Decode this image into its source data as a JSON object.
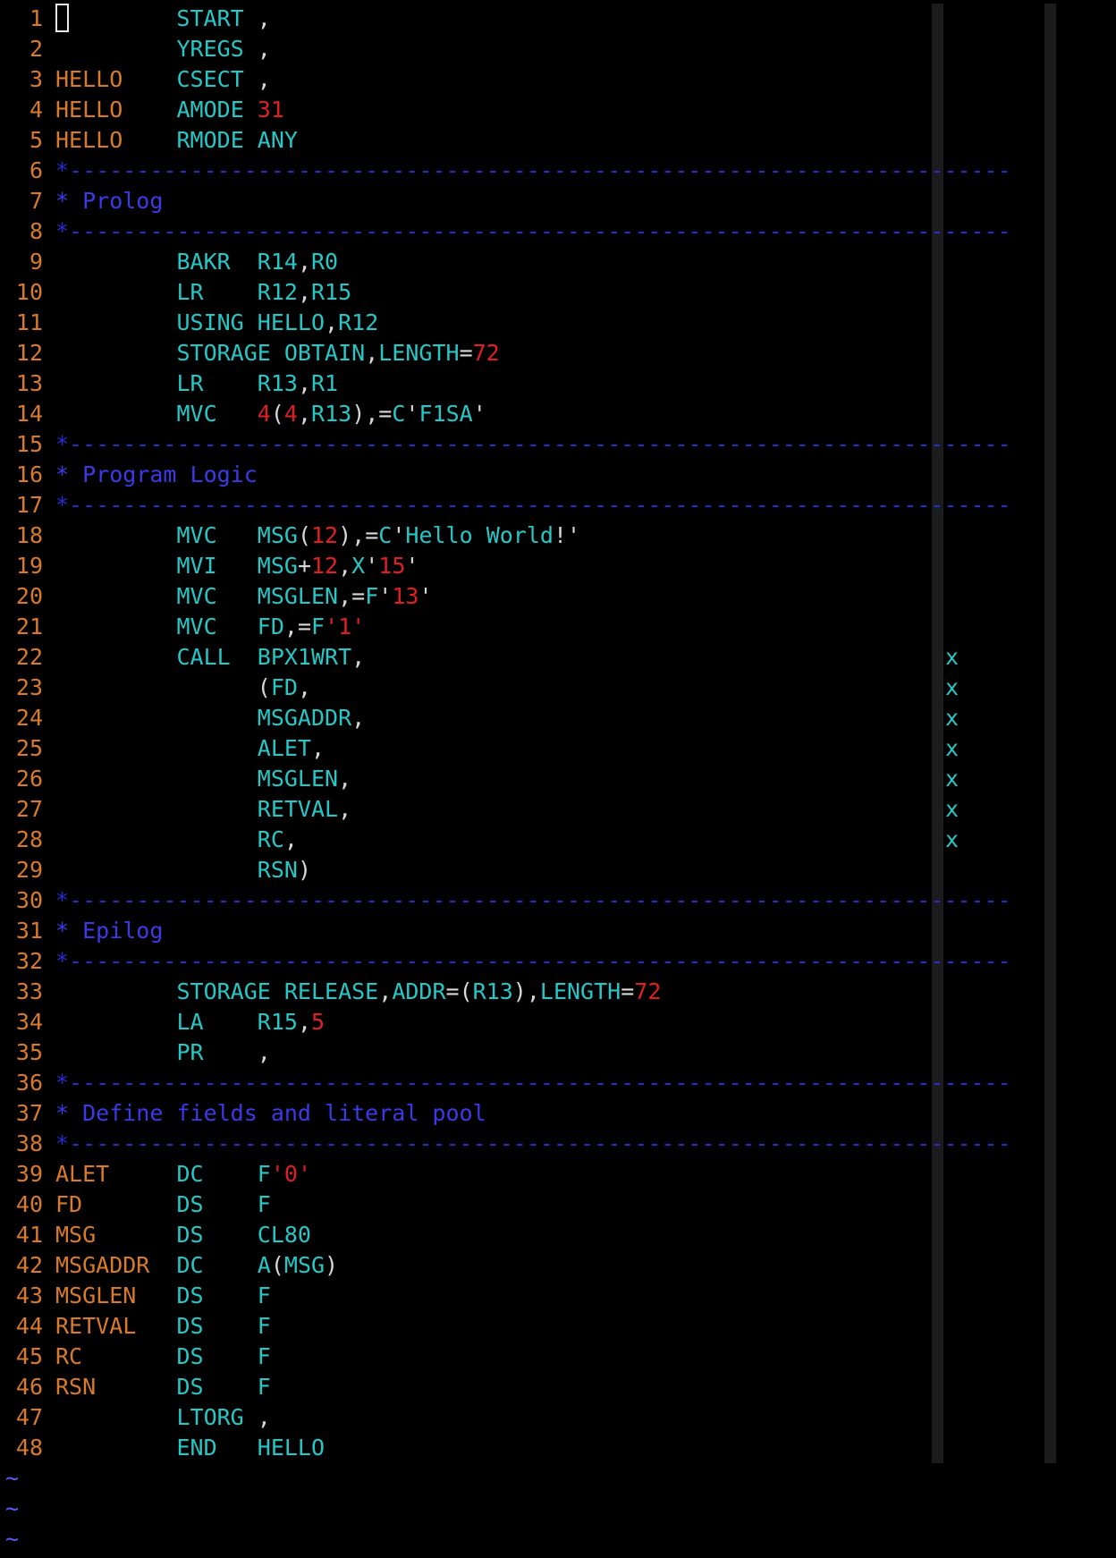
{
  "editor": {
    "lines": [
      {
        "n": "1",
        "cursor": true,
        "tokens": [
          [
            "pad",
            "         "
          ],
          [
            "op",
            "START"
          ],
          [
            "pun",
            " ,"
          ]
        ]
      },
      {
        "n": "2",
        "tokens": [
          [
            "pad",
            "         "
          ],
          [
            "op",
            "YREGS"
          ],
          [
            "pun",
            " ,"
          ]
        ]
      },
      {
        "n": "3",
        "tokens": [
          [
            "lbl",
            "HELLO"
          ],
          [
            "pad",
            "    "
          ],
          [
            "op",
            "CSECT"
          ],
          [
            "pun",
            " ,"
          ]
        ]
      },
      {
        "n": "4",
        "tokens": [
          [
            "lbl",
            "HELLO"
          ],
          [
            "pad",
            "    "
          ],
          [
            "op",
            "AMODE "
          ],
          [
            "num",
            "31"
          ]
        ]
      },
      {
        "n": "5",
        "tokens": [
          [
            "lbl",
            "HELLO"
          ],
          [
            "pad",
            "    "
          ],
          [
            "op",
            "RMODE ANY"
          ]
        ]
      },
      {
        "n": "6",
        "tokens": [
          [
            "dash",
            "*----------------------------------------------------------------------"
          ]
        ]
      },
      {
        "n": "7",
        "tokens": [
          [
            "cmt",
            "* Prolog"
          ]
        ]
      },
      {
        "n": "8",
        "tokens": [
          [
            "dash",
            "*----------------------------------------------------------------------"
          ]
        ]
      },
      {
        "n": "9",
        "tokens": [
          [
            "pad",
            "         "
          ],
          [
            "op",
            "BAKR  R14"
          ],
          [
            "pun",
            ","
          ],
          [
            "op",
            "R0"
          ]
        ]
      },
      {
        "n": "10",
        "tokens": [
          [
            "pad",
            "         "
          ],
          [
            "op",
            "LR    R12"
          ],
          [
            "pun",
            ","
          ],
          [
            "op",
            "R15"
          ]
        ]
      },
      {
        "n": "11",
        "tokens": [
          [
            "pad",
            "         "
          ],
          [
            "op",
            "USING HELLO"
          ],
          [
            "pun",
            ","
          ],
          [
            "op",
            "R12"
          ]
        ]
      },
      {
        "n": "12",
        "tokens": [
          [
            "pad",
            "         "
          ],
          [
            "op",
            "STORAGE OBTAIN"
          ],
          [
            "pun",
            ","
          ],
          [
            "op",
            "LENGTH"
          ],
          [
            "pun",
            "="
          ],
          [
            "num",
            "72"
          ]
        ]
      },
      {
        "n": "13",
        "tokens": [
          [
            "pad",
            "         "
          ],
          [
            "op",
            "LR    R13"
          ],
          [
            "pun",
            ","
          ],
          [
            "op",
            "R1"
          ]
        ]
      },
      {
        "n": "14",
        "tokens": [
          [
            "pad",
            "         "
          ],
          [
            "op",
            "MVC   "
          ],
          [
            "num",
            "4"
          ],
          [
            "pun",
            "("
          ],
          [
            "num",
            "4"
          ],
          [
            "pun",
            ","
          ],
          [
            "op",
            "R13"
          ],
          [
            "pun",
            "),="
          ],
          [
            "op",
            "C"
          ],
          [
            "pun",
            "'"
          ],
          [
            "op",
            "F1SA"
          ],
          [
            "pun",
            "'"
          ]
        ]
      },
      {
        "n": "15",
        "tokens": [
          [
            "dash",
            "*----------------------------------------------------------------------"
          ]
        ]
      },
      {
        "n": "16",
        "tokens": [
          [
            "cmt",
            "* Program Logic"
          ]
        ]
      },
      {
        "n": "17",
        "tokens": [
          [
            "dash",
            "*----------------------------------------------------------------------"
          ]
        ]
      },
      {
        "n": "18",
        "tokens": [
          [
            "pad",
            "         "
          ],
          [
            "op",
            "MVC   MSG"
          ],
          [
            "pun",
            "("
          ],
          [
            "num",
            "12"
          ],
          [
            "pun",
            "),="
          ],
          [
            "op",
            "C"
          ],
          [
            "pun",
            "'"
          ],
          [
            "op",
            "Hello World"
          ],
          [
            "pun",
            "!'"
          ]
        ]
      },
      {
        "n": "19",
        "tokens": [
          [
            "pad",
            "         "
          ],
          [
            "op",
            "MVI   MSG"
          ],
          [
            "pun",
            "+"
          ],
          [
            "num",
            "12"
          ],
          [
            "pun",
            ","
          ],
          [
            "op",
            "X"
          ],
          [
            "pun",
            "'"
          ],
          [
            "num",
            "15"
          ],
          [
            "pun",
            "'"
          ]
        ]
      },
      {
        "n": "20",
        "tokens": [
          [
            "pad",
            "         "
          ],
          [
            "op",
            "MVC   MSGLEN"
          ],
          [
            "pun",
            ",="
          ],
          [
            "op",
            "F"
          ],
          [
            "pun",
            "'"
          ],
          [
            "num",
            "13"
          ],
          [
            "pun",
            "'"
          ]
        ]
      },
      {
        "n": "21",
        "tokens": [
          [
            "pad",
            "         "
          ],
          [
            "op",
            "MVC   FD"
          ],
          [
            "pun",
            ",="
          ],
          [
            "op",
            "F"
          ],
          [
            "num",
            "'1'"
          ]
        ]
      },
      {
        "n": "22",
        "cont": "x",
        "tokens": [
          [
            "pad",
            "         "
          ],
          [
            "op",
            "CALL  BPX1WRT"
          ],
          [
            "pun",
            ","
          ]
        ]
      },
      {
        "n": "23",
        "cont": "x",
        "tokens": [
          [
            "pad",
            "               "
          ],
          [
            "pun",
            "("
          ],
          [
            "op",
            "FD"
          ],
          [
            "pun",
            ","
          ]
        ]
      },
      {
        "n": "24",
        "cont": "x",
        "tokens": [
          [
            "pad",
            "               "
          ],
          [
            "op",
            "MSGADDR"
          ],
          [
            "pun",
            ","
          ]
        ]
      },
      {
        "n": "25",
        "cont": "x",
        "tokens": [
          [
            "pad",
            "               "
          ],
          [
            "op",
            "ALET"
          ],
          [
            "pun",
            ","
          ]
        ]
      },
      {
        "n": "26",
        "cont": "x",
        "tokens": [
          [
            "pad",
            "               "
          ],
          [
            "op",
            "MSGLEN"
          ],
          [
            "pun",
            ","
          ]
        ]
      },
      {
        "n": "27",
        "cont": "x",
        "tokens": [
          [
            "pad",
            "               "
          ],
          [
            "op",
            "RETVAL"
          ],
          [
            "pun",
            ","
          ]
        ]
      },
      {
        "n": "28",
        "cont": "x",
        "tokens": [
          [
            "pad",
            "               "
          ],
          [
            "op",
            "RC"
          ],
          [
            "pun",
            ","
          ]
        ]
      },
      {
        "n": "29",
        "tokens": [
          [
            "pad",
            "               "
          ],
          [
            "op",
            "RSN"
          ],
          [
            "pun",
            ")"
          ]
        ]
      },
      {
        "n": "30",
        "tokens": [
          [
            "dash",
            "*----------------------------------------------------------------------"
          ]
        ]
      },
      {
        "n": "31",
        "tokens": [
          [
            "cmt",
            "* Epilog"
          ]
        ]
      },
      {
        "n": "32",
        "tokens": [
          [
            "dash",
            "*----------------------------------------------------------------------"
          ]
        ]
      },
      {
        "n": "33",
        "tokens": [
          [
            "pad",
            "         "
          ],
          [
            "op",
            "STORAGE RELEASE"
          ],
          [
            "pun",
            ","
          ],
          [
            "op",
            "ADDR"
          ],
          [
            "pun",
            "=("
          ],
          [
            "op",
            "R13"
          ],
          [
            "pun",
            "),"
          ],
          [
            "op",
            "LENGTH"
          ],
          [
            "pun",
            "="
          ],
          [
            "num",
            "72"
          ]
        ]
      },
      {
        "n": "34",
        "tokens": [
          [
            "pad",
            "         "
          ],
          [
            "op",
            "LA    R15"
          ],
          [
            "pun",
            ","
          ],
          [
            "num",
            "5"
          ]
        ]
      },
      {
        "n": "35",
        "tokens": [
          [
            "pad",
            "         "
          ],
          [
            "op",
            "PR"
          ],
          [
            "pun",
            "    ,"
          ]
        ]
      },
      {
        "n": "36",
        "tokens": [
          [
            "dash",
            "*----------------------------------------------------------------------"
          ]
        ]
      },
      {
        "n": "37",
        "tokens": [
          [
            "cmt",
            "* Define fields and literal pool"
          ]
        ]
      },
      {
        "n": "38",
        "tokens": [
          [
            "dash",
            "*----------------------------------------------------------------------"
          ]
        ]
      },
      {
        "n": "39",
        "tokens": [
          [
            "lbl",
            "ALET"
          ],
          [
            "pad",
            "     "
          ],
          [
            "op",
            "DC    F"
          ],
          [
            "num",
            "'0'"
          ]
        ]
      },
      {
        "n": "40",
        "tokens": [
          [
            "lbl",
            "FD"
          ],
          [
            "pad",
            "       "
          ],
          [
            "op",
            "DS    F"
          ]
        ]
      },
      {
        "n": "41",
        "tokens": [
          [
            "lbl",
            "MSG"
          ],
          [
            "pad",
            "      "
          ],
          [
            "op",
            "DS    CL80"
          ]
        ]
      },
      {
        "n": "42",
        "tokens": [
          [
            "lbl",
            "MSGADDR"
          ],
          [
            "pad",
            "  "
          ],
          [
            "op",
            "DC    A"
          ],
          [
            "pun",
            "("
          ],
          [
            "op",
            "MSG"
          ],
          [
            "pun",
            ")"
          ]
        ]
      },
      {
        "n": "43",
        "tokens": [
          [
            "lbl",
            "MSGLEN"
          ],
          [
            "pad",
            "   "
          ],
          [
            "op",
            "DS    F"
          ]
        ]
      },
      {
        "n": "44",
        "tokens": [
          [
            "lbl",
            "RETVAL"
          ],
          [
            "pad",
            "   "
          ],
          [
            "op",
            "DS    F"
          ]
        ]
      },
      {
        "n": "45",
        "tokens": [
          [
            "lbl",
            "RC"
          ],
          [
            "pad",
            "       "
          ],
          [
            "op",
            "DS    F"
          ]
        ]
      },
      {
        "n": "46",
        "tokens": [
          [
            "lbl",
            "RSN"
          ],
          [
            "pad",
            "      "
          ],
          [
            "op",
            "DS    F"
          ]
        ]
      },
      {
        "n": "47",
        "tokens": [
          [
            "pad",
            "         "
          ],
          [
            "op",
            "LTORG"
          ],
          [
            "pun",
            " ,"
          ]
        ]
      },
      {
        "n": "48",
        "tokens": [
          [
            "pad",
            "         "
          ],
          [
            "op",
            "END   HELLO"
          ]
        ]
      }
    ],
    "tildes": [
      "~",
      "~",
      "~"
    ]
  },
  "colors": {
    "background": "#000000",
    "line_number": "#d97a2a",
    "label": "#d97a2a",
    "operation": "#25c7c7",
    "number": "#e02020",
    "comment": "#3a3ae8",
    "punctuation": "#d8d8d8",
    "tilde": "#5a5aff",
    "column_guide": "#1c1c1c"
  }
}
